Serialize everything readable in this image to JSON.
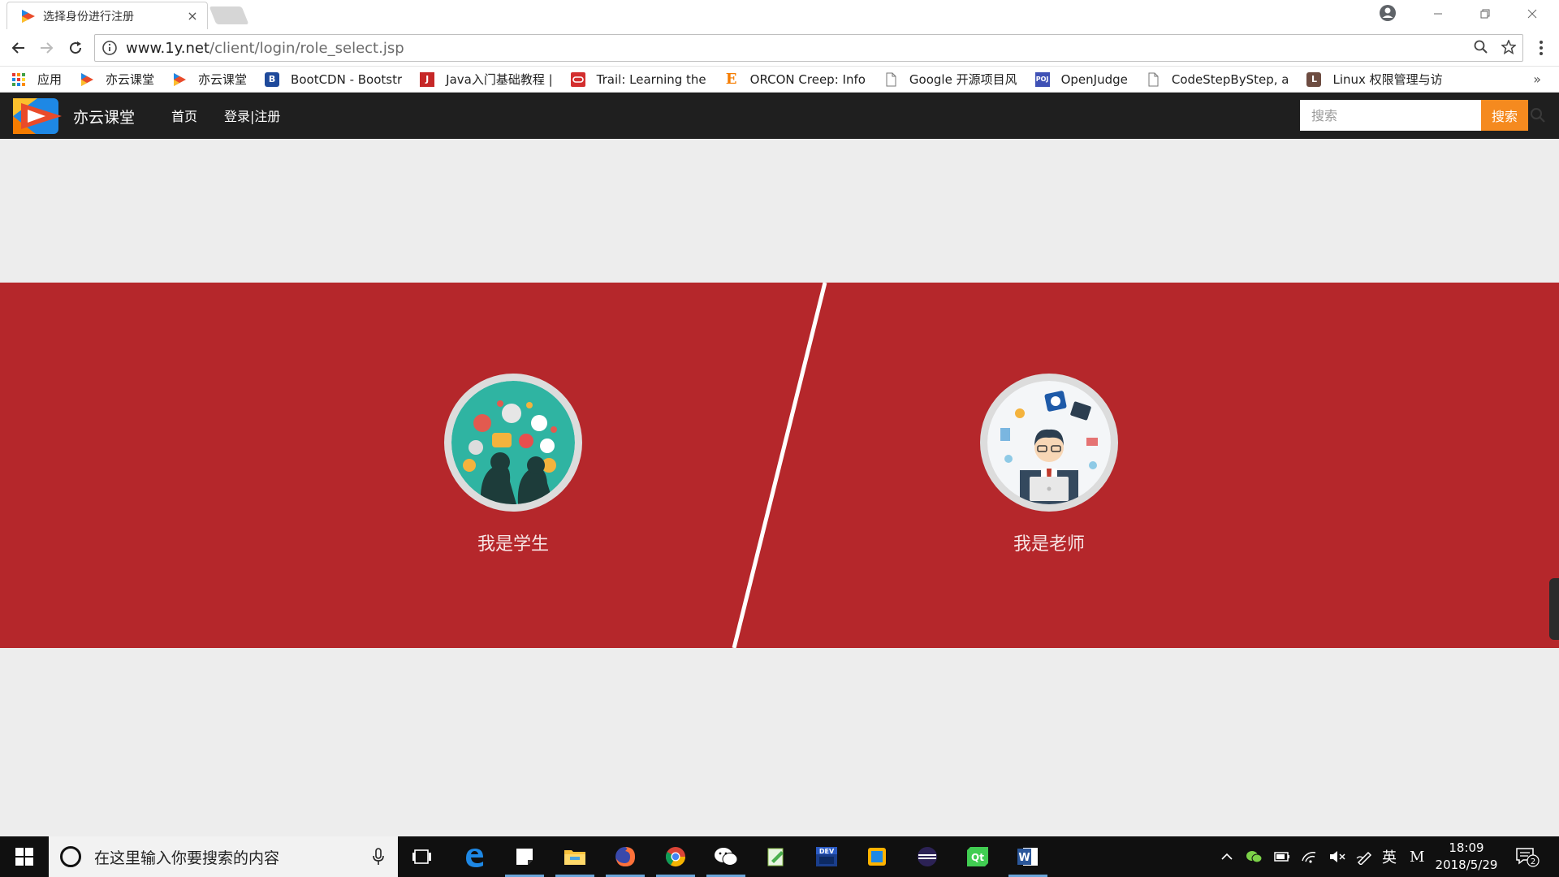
{
  "browser": {
    "tab_title": "选择身份进行注册",
    "tab_close": "×",
    "url_host": "www.1y.net",
    "url_path": "/client/login/role_select.jsp",
    "bookmarks": [
      {
        "label": "应用",
        "icon": "apps-grid-icon"
      },
      {
        "label": "亦云课堂",
        "icon": "yiyun-logo-icon"
      },
      {
        "label": "亦云课堂",
        "icon": "yiyun-logo-icon"
      },
      {
        "label": "BootCDN - Bootstr",
        "icon": "bootcdn-icon"
      },
      {
        "label": "Java入门基础教程 | ",
        "icon": "java-tutorial-icon"
      },
      {
        "label": "Trail: Learning the",
        "icon": "oracle-icon"
      },
      {
        "label": "ORCON Creep: Info",
        "icon": "orcon-e-icon"
      },
      {
        "label": "Google 开源项目风",
        "icon": "page-icon"
      },
      {
        "label": "OpenJudge",
        "icon": "poj-icon"
      },
      {
        "label": "CodeStepByStep, a",
        "icon": "page-icon"
      },
      {
        "label": "Linux 权限管理与访",
        "icon": "linux-icon"
      }
    ],
    "bookmarks_more": "»"
  },
  "site": {
    "brand": "亦云课堂",
    "nav_home": "首页",
    "nav_login": "登录|注册",
    "search_placeholder": "搜索",
    "search_button": "搜索"
  },
  "roles": {
    "student": "我是学生",
    "teacher": "我是老师"
  },
  "taskbar": {
    "search_placeholder": "在这里输入你要搜索的内容",
    "ime": "英",
    "ime2": "M",
    "time": "18:09",
    "date": "2018/5/29",
    "notification_count": "2"
  },
  "colors": {
    "band_red": "#b5272b",
    "search_orange": "#f58a1f",
    "navbar": "#1f1f1f",
    "page_bg": "#ededed"
  }
}
